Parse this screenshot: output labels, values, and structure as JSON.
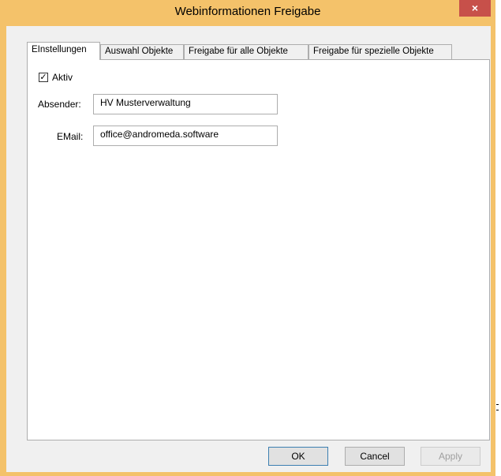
{
  "window": {
    "title": "Webinformationen Freigabe"
  },
  "titlebar": {
    "close_glyph": "×"
  },
  "tabs": [
    {
      "label": "EInstellungen",
      "active": true
    },
    {
      "label": "Auswahl Objekte",
      "active": false
    },
    {
      "label": "Freigabe für alle Objekte",
      "active": false
    },
    {
      "label": "Freigabe für spezielle Objekte",
      "active": false
    }
  ],
  "form": {
    "aktiv_label": "Aktiv",
    "aktiv_checked": true,
    "absender_label": "Absender:",
    "absender_value": "HV Musterverwaltung",
    "email_label": "EMail:",
    "email_value": "office@andromeda.software"
  },
  "buttons": {
    "ok": "OK",
    "cancel": "Cancel",
    "apply": "Apply"
  },
  "colors": {
    "frame": "#f4c26a",
    "close": "#c7504a",
    "client": "#f0f0f0"
  }
}
